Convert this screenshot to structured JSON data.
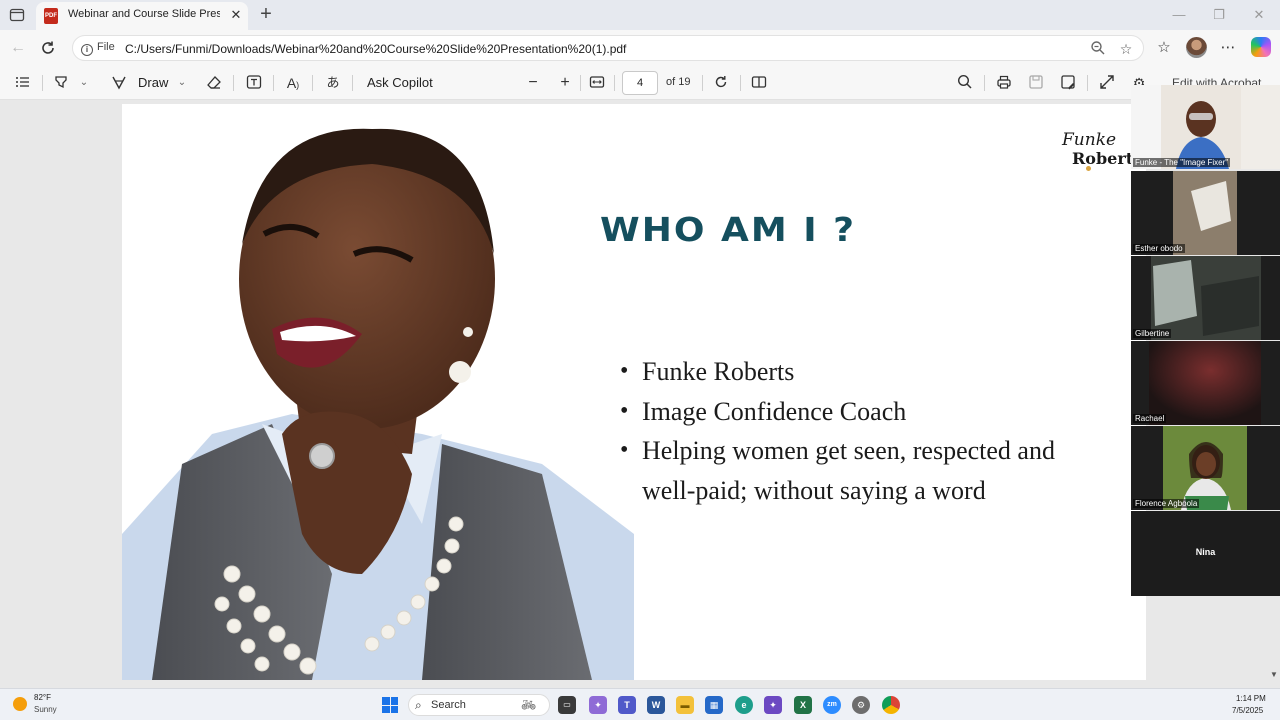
{
  "browser": {
    "tab_title": "Webinar and Course Slide Presen",
    "address_scheme": "File",
    "url": "C:/Users/Funmi/Downloads/Webinar%20and%20Course%20Slide%20Presentation%20(1).pdf"
  },
  "pdf_toolbar": {
    "draw_label": "Draw",
    "ask_copilot_label": "Ask Copilot",
    "current_page": "4",
    "page_total": "of 19",
    "edit_label": "Edit with Acrobat"
  },
  "slide": {
    "title": "WHO AM I ?",
    "bullets": [
      "Funke Roberts",
      "Image Confidence Coach",
      "Helping women get seen, respected and well-paid; without saying a word"
    ],
    "logo_line1": "Funke",
    "logo_line2": "Roberts"
  },
  "participants": [
    {
      "name": "Funke - The \"Image Fixer\""
    },
    {
      "name": "Esther obodo"
    },
    {
      "name": "Gilbertine"
    },
    {
      "name": "Rachael"
    },
    {
      "name": "Florence Agboola"
    },
    {
      "name": "Nina"
    }
  ],
  "taskbar": {
    "weather_temp": "82°F",
    "weather_condition": "Sunny",
    "search_label": "Search",
    "time": "1:14 PM",
    "date": "7/5/2025"
  },
  "colors": {
    "slide_title": "#154f5e",
    "tab_favicon": "#c42b1c",
    "windows_blue": "#1a73e8"
  }
}
